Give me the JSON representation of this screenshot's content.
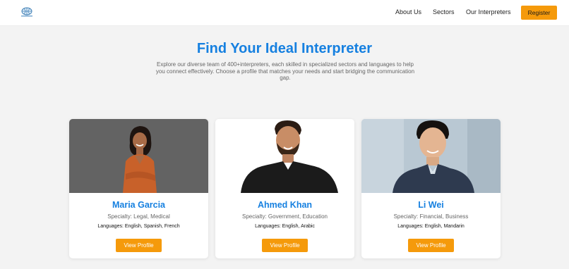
{
  "nav": {
    "logo_icon": "globe-logo-icon",
    "links": [
      "About Us",
      "Sectors",
      "Our Interpreters"
    ],
    "register_label": "Register"
  },
  "hero": {
    "title": "Find Your Ideal Interpreter",
    "subtitle": "Explore our diverse team of 400+interpreters, each skilled in specialized sectors and languages to help you connect effectively. Choose a profile that matches your needs and start bridging the communication gap."
  },
  "interpreters": [
    {
      "name": "Maria Garcia",
      "specialty": "Specialty: Legal, Medical",
      "languages": "Languages: English, Spanish, French",
      "button": "View Profile"
    },
    {
      "name": "Ahmed Khan",
      "specialty": "Specialty: Government, Education",
      "languages": "Languages: English, Arabic",
      "button": "View Profile"
    },
    {
      "name": "Li Wei",
      "specialty": "Specialty: Financial, Business",
      "languages": "Languages: English, Mandarin",
      "button": "View Profile"
    }
  ],
  "colors": {
    "accent_blue": "#1680e0",
    "button_orange": "#f59a0b",
    "page_bg": "#f3f3f3"
  }
}
